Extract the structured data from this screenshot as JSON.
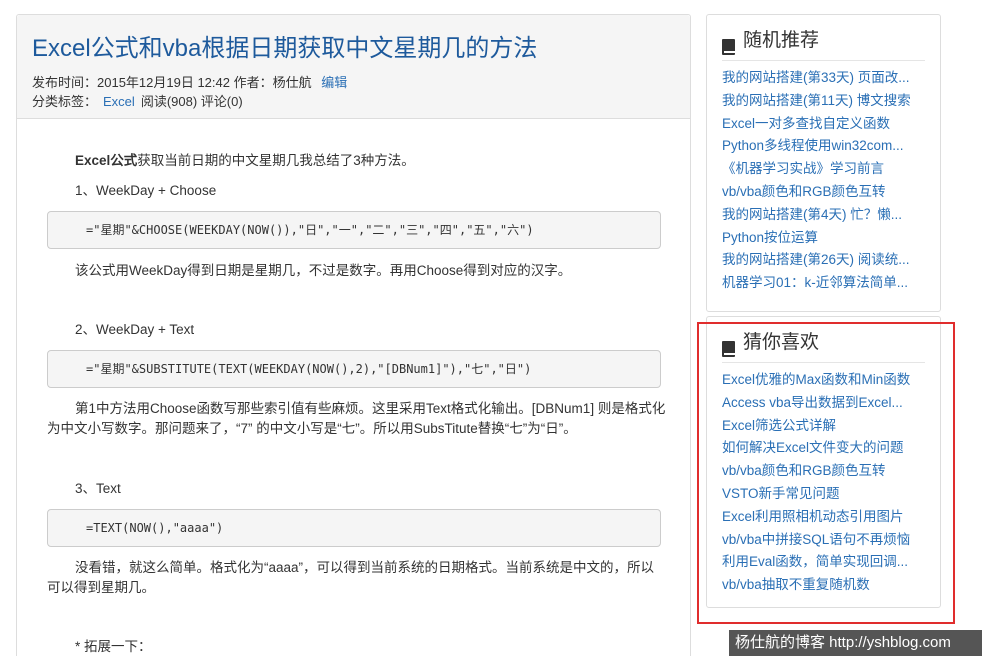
{
  "article": {
    "title": "Excel公式和vba根据日期获取中文星期几的方法",
    "meta_line1_prefix": "发布时间：2015年12月19日  12:42   作者：杨仕航  ",
    "edit_link": "编辑",
    "meta_line2_prefix": "分类标签：",
    "category_link": "Excel",
    "meta_line2_suffix": "阅读(908)  评论(0)",
    "intro_bold": "Excel公式",
    "intro_rest": "获取当前日期的中文星期几我总结了3种方法。",
    "section1": "1、WeekDay + Choose",
    "code1": "=\"星期\"&CHOOSE(WEEKDAY(NOW()),\"日\",\"一\",\"二\",\"三\",\"四\",\"五\",\"六\")",
    "para1": "该公式用WeekDay得到日期是星期几，不过是数字。再用Choose得到对应的汉字。",
    "section2": "2、WeekDay + Text",
    "code2": "=\"星期\"&SUBSTITUTE(TEXT(WEEKDAY(NOW(),2),\"[DBNum1]\"),\"七\",\"日\")",
    "para2": "第1中方法用Choose函数写那些索引值有些麻烦。这里采用Text格式化输出。[DBNum1] 则是格式化为中文小写数字。那问题来了，“7” 的中文小写是“七”。所以用SubsTitute替换“七”为“日”。",
    "section3": "3、Text",
    "code3": "=TEXT(NOW(),\"aaaa\")",
    "para3": "没看错，就这么简单。格式化为“aaaa”，可以得到当前系统的日期格式。当前系统是中文的，所以可以得到星期几。",
    "ext": "* 拓展一下："
  },
  "random_widget": {
    "title": "随机推荐",
    "items": [
      "我的网站搭建(第33天) 页面改...",
      "我的网站搭建(第11天) 博文搜索",
      "Excel一对多查找自定义函数",
      "Python多线程使用win32com...",
      "《机器学习实战》学习前言",
      "vb/vba颜色和RGB颜色互转",
      "我的网站搭建(第4天) 忙？懒...",
      "Python按位运算",
      "我的网站搭建(第26天) 阅读统...",
      "机器学习01：k-近邻算法简单..."
    ]
  },
  "guess_widget": {
    "title": "猜你喜欢",
    "items": [
      "Excel优雅的Max函数和Min函数",
      "Access vba导出数据到Excel...",
      "Excel筛选公式详解",
      "如何解决Excel文件变大的问题",
      "vb/vba颜色和RGB颜色互转",
      "VSTO新手常见问题",
      "Excel利用照相机动态引用图片",
      "vb/vba中拼接SQL语句不再烦恼",
      "利用Eval函数，简单实现回调...",
      "vb/vba抽取不重复随机数"
    ]
  },
  "watermark": "杨仕航的博客 http://yshblog.com",
  "colors": {
    "link": "#2a6fb5",
    "title": "#1e5a9c",
    "highlight": "#e02d2d"
  }
}
